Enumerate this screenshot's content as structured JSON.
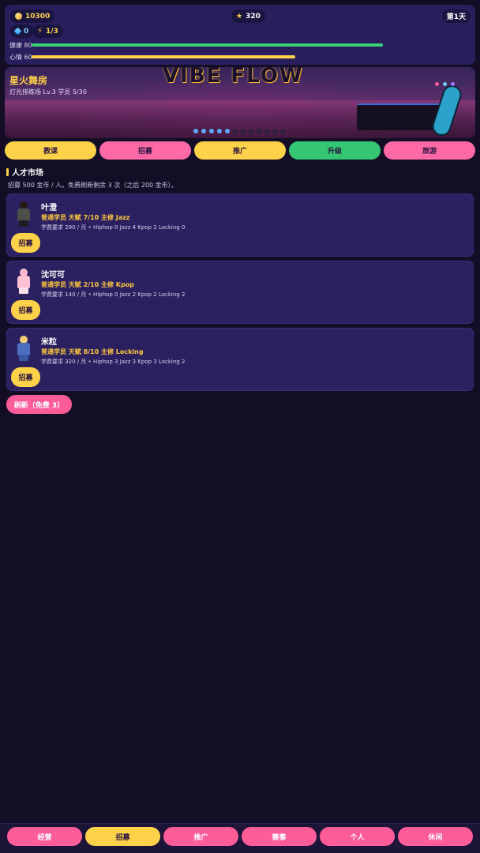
{
  "status": {
    "coins": "10300",
    "stars": "320",
    "day": "第1天",
    "gems": "0",
    "energy": "1/3",
    "health_label": "健康 80",
    "health_value": 80,
    "mood_label": "心情 60",
    "mood_value": 60,
    "colors": {
      "health": "#3ad27a",
      "mood": "#ffd24a"
    }
  },
  "banner": {
    "title": "星火舞房",
    "subtitle": "灯光排练场 Lv.3 学员 5/30",
    "graffiti": "VIBE FLOW",
    "slide_count": 12,
    "active_slides": 5
  },
  "actions": [
    {
      "label": "教课",
      "color": "#ffd24a"
    },
    {
      "label": "招募",
      "color": "#ff6aa6"
    },
    {
      "label": "推广",
      "color": "#ffd24a"
    },
    {
      "label": "升级",
      "color": "#34c672"
    },
    {
      "label": "旅游",
      "color": "#ff6aa6"
    }
  ],
  "market": {
    "title": "人才市场",
    "desc": "招募 500 金币 / 人。免费刷新剩余 3 次（之后 200 金币）。",
    "recruit_label": "招募",
    "refresh_label": "刷新（免费 3）",
    "candidates": [
      {
        "name": "叶澄",
        "attr": "普通学员  天赋 7/10  主修 Jazz",
        "req": "学费要求 290 / 月   •   Hiphop 0  Jazz 4  Kpop 2  Locking 0",
        "avatar": "dark-jacket-dancer-icon"
      },
      {
        "name": "沈可可",
        "attr": "普通学员  天赋 2/10  主修 Kpop",
        "req": "学费要求 140 / 月   •   Hiphop 0  Jazz 2  Kpop 2  Locking 2",
        "avatar": "pink-dress-dancer-icon"
      },
      {
        "name": "米粒",
        "attr": "普通学员  天赋 8/10  主修 Locking",
        "req": "学费要求 320 / 月   •   Hiphop 3  Jazz 3  Kpop 3  Locking 2",
        "avatar": "overalls-dancer-icon"
      }
    ]
  },
  "nav": [
    {
      "label": "经营",
      "active": false
    },
    {
      "label": "招募",
      "active": true
    },
    {
      "label": "推广",
      "active": false
    },
    {
      "label": "赛事",
      "active": false
    },
    {
      "label": "个人",
      "active": false
    },
    {
      "label": "休闲",
      "active": false
    }
  ]
}
